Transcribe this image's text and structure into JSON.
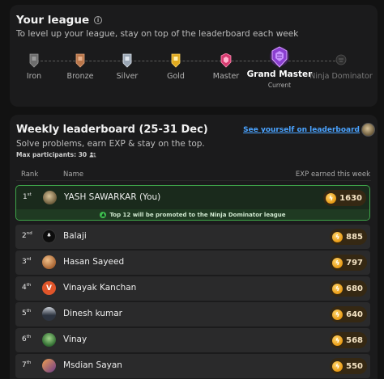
{
  "league": {
    "title": "Your league",
    "subtitle": "To level up your league, stay on top of the leaderboard each week",
    "current_tag": "Current",
    "tiers": [
      {
        "label": "Iron",
        "color": "#7b7b7b"
      },
      {
        "label": "Bronze",
        "color": "#c98a5e"
      },
      {
        "label": "Silver",
        "color": "#aeb9c6"
      },
      {
        "label": "Gold",
        "color": "#e6b423"
      },
      {
        "label": "Master",
        "color": "#e0457b"
      },
      {
        "label": "Grand Master",
        "color": "#9b4fd6"
      },
      {
        "label": "Ninja Dominator",
        "color": "#555555"
      }
    ]
  },
  "leaderboard": {
    "title": "Weekly leaderboard (25-31 Dec)",
    "subtitle": "Solve problems, earn EXP & stay on the top.",
    "max_participants": "Max participants: 30",
    "see_yourself": "See yourself on leaderboard",
    "columns": {
      "rank": "Rank",
      "name": "Name",
      "exp": "EXP earned this week"
    },
    "promo_text": "Top 12 will be promoted to the Ninja Dominator league",
    "rows": [
      {
        "rank": "1",
        "suffix": "st",
        "name": "YASH SAWARKAR (You)",
        "exp": "1630",
        "avatar_color": "#8a7a5a"
      },
      {
        "rank": "2",
        "suffix": "nd",
        "name": "Balaji",
        "exp": "885",
        "avatar_color": "#111111"
      },
      {
        "rank": "3",
        "suffix": "rd",
        "name": "Hasan Sayeed",
        "exp": "797",
        "avatar_color": "#c8874a"
      },
      {
        "rank": "4",
        "suffix": "th",
        "name": "Vinayak Kanchan",
        "exp": "680",
        "avatar_color": "#e0552a",
        "initial": "V"
      },
      {
        "rank": "5",
        "suffix": "th",
        "name": "Dinesh kumar",
        "exp": "640",
        "avatar_color": "#556070"
      },
      {
        "rank": "6",
        "suffix": "th",
        "name": "Vinay",
        "exp": "568",
        "avatar_color": "#4a8a3a"
      },
      {
        "rank": "7",
        "suffix": "th",
        "name": "Msdian Sayan",
        "exp": "550",
        "avatar_color": "#c86a3a"
      }
    ]
  }
}
